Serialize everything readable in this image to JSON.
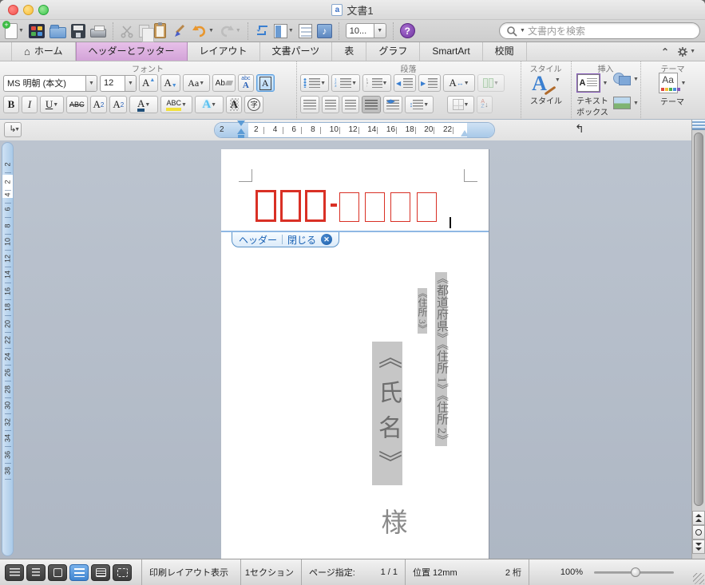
{
  "window": {
    "title": "文書1"
  },
  "toolbar": {
    "zoom_value": "10...",
    "search_placeholder": "文書内を検索"
  },
  "tabs": [
    {
      "label": "ホーム",
      "icon": "home",
      "active": false
    },
    {
      "label": "ヘッダーとフッター",
      "active": true
    },
    {
      "label": "レイアウト",
      "active": false
    },
    {
      "label": "文書パーツ",
      "active": false
    },
    {
      "label": "表",
      "active": false
    },
    {
      "label": "グラフ",
      "active": false
    },
    {
      "label": "SmartArt",
      "active": false
    },
    {
      "label": "校閲",
      "active": false
    }
  ],
  "ribbon": {
    "group_labels": {
      "font": "フォント",
      "paragraph": "段落",
      "styles": "スタイル",
      "insert": "挿入",
      "themes": "テーマ"
    },
    "font": {
      "name": "MS 明朝 (本文)",
      "size": "12"
    },
    "styles": {
      "button_label": "スタイル"
    },
    "insert": {
      "textbox_label_1": "テキスト",
      "textbox_label_2": "ボックス"
    },
    "themes": {
      "button_label": "テーマ"
    }
  },
  "ruler": {
    "h_margin_number": "2",
    "h_numbers": [
      "2",
      "4",
      "6",
      "8",
      "10",
      "12",
      "14",
      "16",
      "18",
      "20",
      "22"
    ],
    "v_margin_number": "2",
    "v_white_numbers": [
      "2",
      "4"
    ],
    "v_numbers": [
      "6",
      "8",
      "10",
      "12",
      "14",
      "16",
      "18",
      "20",
      "22",
      "24",
      "26",
      "28",
      "30",
      "32",
      "34",
      "36",
      "38"
    ]
  },
  "document": {
    "header_bar": {
      "header_label": "ヘッダー",
      "close_label": "閉じる"
    },
    "postal_boxes": {
      "thick": 3,
      "thin": 4
    },
    "fields": {
      "address_line1": "《都道府県》《住所 1》《住所 2》",
      "address_line2": "《住所 3》",
      "name": "《氏名》",
      "honorific": "様"
    }
  },
  "statusbar": {
    "view_mode": "印刷レイアウト表示",
    "section": "1セクション",
    "page_label": "ページ指定:",
    "page_value": "1 / 1",
    "position": "位置 12mm",
    "digits": "2 桁",
    "zoom_percent": "100%"
  }
}
